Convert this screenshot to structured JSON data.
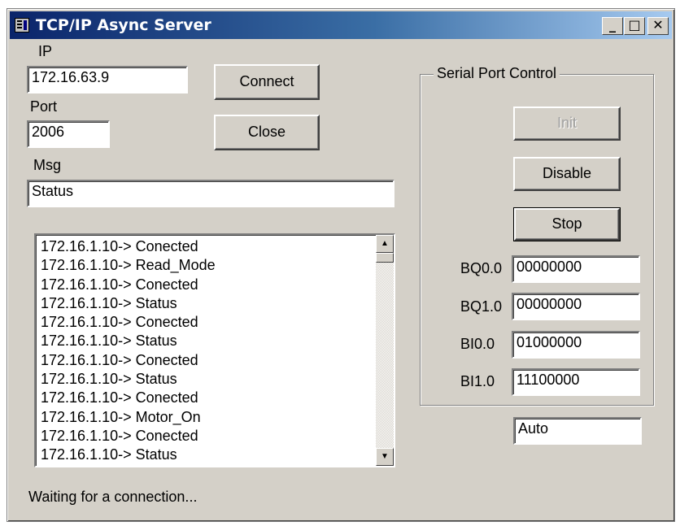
{
  "window": {
    "title": "TCP/IP Async Server",
    "minimize_glyph": "_",
    "maximize_glyph": "□",
    "close_glyph": "✕"
  },
  "connection": {
    "ip_label": "IP",
    "ip_value": "172.16.63.9",
    "port_label": "Port",
    "port_value": "2006",
    "msg_label": "Msg",
    "msg_value": "Status",
    "connect_label": "Connect",
    "close_label": "Close"
  },
  "log": {
    "items": [
      "172.16.1.10-> Conected",
      "172.16.1.10-> Read_Mode",
      "172.16.1.10-> Conected",
      "172.16.1.10-> Status",
      "172.16.1.10-> Conected",
      "172.16.1.10-> Status",
      "172.16.1.10-> Conected",
      "172.16.1.10-> Status",
      "172.16.1.10-> Conected",
      "172.16.1.10-> Motor_On",
      "172.16.1.10-> Conected",
      "172.16.1.10-> Status"
    ]
  },
  "serial": {
    "group_label": "Serial Port Control",
    "init_label": "Init",
    "disable_label": "Disable",
    "stop_label": "Stop",
    "bq0_label": "BQ0.0",
    "bq0_value": "00000000",
    "bq1_label": "BQ1.0",
    "bq1_value": "00000000",
    "bi0_label": "BI0.0",
    "bi0_value": "01000000",
    "bi1_label": "BI1.0",
    "bi1_value": "11100000"
  },
  "mode_value": "Auto",
  "status_text": "Waiting for a connection..."
}
